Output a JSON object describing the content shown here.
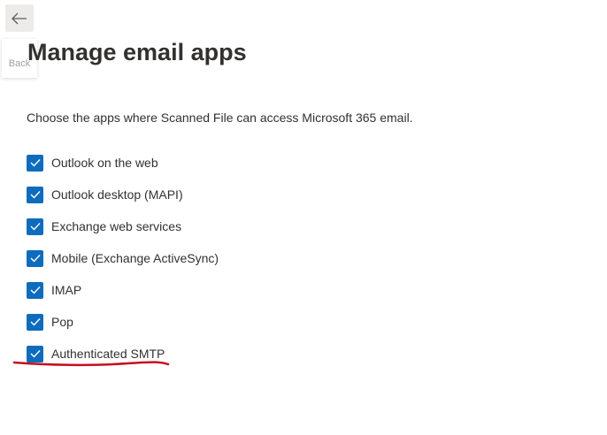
{
  "back": {
    "tooltip": "Back"
  },
  "title": "Manage email apps",
  "description": "Choose the apps where Scanned File can access Microsoft 365 email.",
  "apps": [
    {
      "label": "Outlook on the web",
      "checked": true
    },
    {
      "label": "Outlook desktop (MAPI)",
      "checked": true
    },
    {
      "label": "Exchange web services",
      "checked": true
    },
    {
      "label": "Mobile (Exchange ActiveSync)",
      "checked": true
    },
    {
      "label": "IMAP",
      "checked": true
    },
    {
      "label": "Pop",
      "checked": true
    },
    {
      "label": "Authenticated SMTP",
      "checked": true
    }
  ],
  "colors": {
    "accent": "#0f6cbd",
    "annotation": "#c50f1f"
  }
}
